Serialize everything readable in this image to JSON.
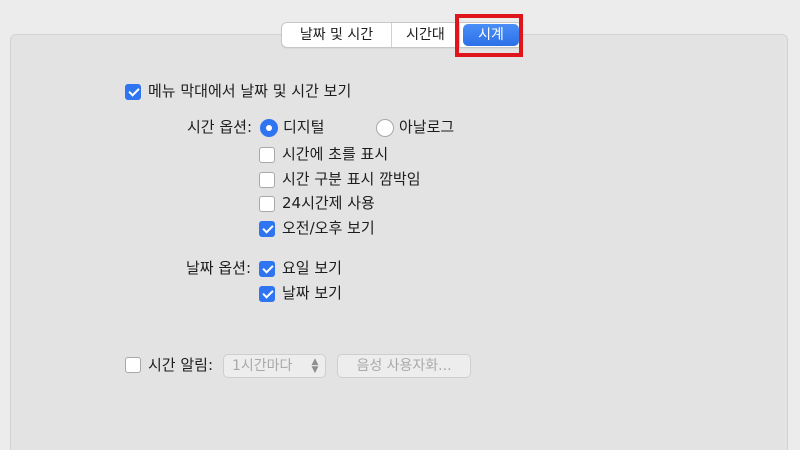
{
  "tabs": [
    {
      "label": "날짜 및 시간",
      "active": false
    },
    {
      "label": "시간대",
      "active": false
    },
    {
      "label": "시계",
      "active": true
    }
  ],
  "show_in_menubar": {
    "label": "메뉴 막대에서 날짜 및 시간 보기",
    "checked": true
  },
  "time_options": {
    "label": "시간 옵션:",
    "digital": {
      "label": "디지털",
      "selected": true
    },
    "analog": {
      "label": "아날로그",
      "selected": false
    },
    "checkboxes": [
      {
        "label": "시간에 초를 표시",
        "checked": false
      },
      {
        "label": "시간 구분 표시 깜박임",
        "checked": false
      },
      {
        "label": "24시간제 사용",
        "checked": false
      },
      {
        "label": "오전/오후 보기",
        "checked": true
      }
    ]
  },
  "date_options": {
    "label": "날짜 옵션:",
    "checkboxes": [
      {
        "label": "요일 보기",
        "checked": true
      },
      {
        "label": "날짜 보기",
        "checked": true
      }
    ]
  },
  "announce": {
    "label": "시간 알림:",
    "checked": false,
    "interval": "1시간마다",
    "customize_voice": "음성 사용자화..."
  },
  "colors": {
    "accent": "#2f74f0",
    "highlight": "#e0141b"
  }
}
